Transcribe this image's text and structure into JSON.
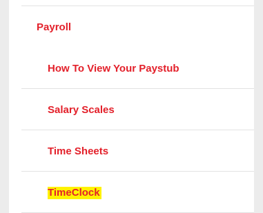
{
  "section": {
    "title": "Payroll"
  },
  "menu": {
    "items": [
      {
        "label": "How To View Your Paystub"
      },
      {
        "label": "Salary Scales"
      },
      {
        "label": "Time Sheets"
      },
      {
        "label": "TimeClock",
        "highlighted": true
      }
    ]
  },
  "colors": {
    "link": "#e3202a",
    "highlight": "#fff200",
    "divider": "#e2e2e2",
    "page_background": "#ececec"
  }
}
